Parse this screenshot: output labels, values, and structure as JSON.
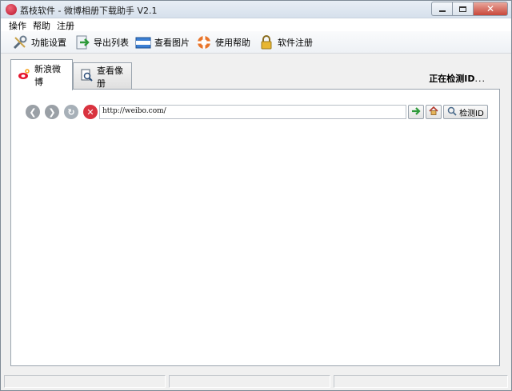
{
  "window": {
    "title": "荔枝软件 - 微博相册下载助手 V2.1",
    "colors": {
      "titlebar": "#dbe4ee",
      "close_button": "#c8473a",
      "accent": "#2a6cc4"
    }
  },
  "menu": {
    "items": [
      "操作",
      "帮助",
      "注册"
    ]
  },
  "toolbar": {
    "items": [
      {
        "label": "功能设置",
        "icon": "tools-icon"
      },
      {
        "label": "导出列表",
        "icon": "export-icon"
      },
      {
        "label": "查看图片",
        "icon": "folder-icon"
      },
      {
        "label": "使用帮助",
        "icon": "lifebuoy-icon"
      },
      {
        "label": "软件注册",
        "icon": "lock-icon"
      }
    ]
  },
  "tabs": [
    {
      "label": "新浪微博",
      "icon": "weibo-icon",
      "active": true
    },
    {
      "label": "查看像册",
      "icon": "album-icon",
      "active": false
    }
  ],
  "status": {
    "detect_text": "正在检测ID",
    "dots": "..."
  },
  "browser": {
    "url": "http://weibo.com/",
    "go_icon": "arrow-right-icon",
    "home_icon": "home-icon",
    "detect_button_label": "检测ID"
  },
  "statusbar": {
    "segments": [
      "",
      "",
      ""
    ]
  }
}
